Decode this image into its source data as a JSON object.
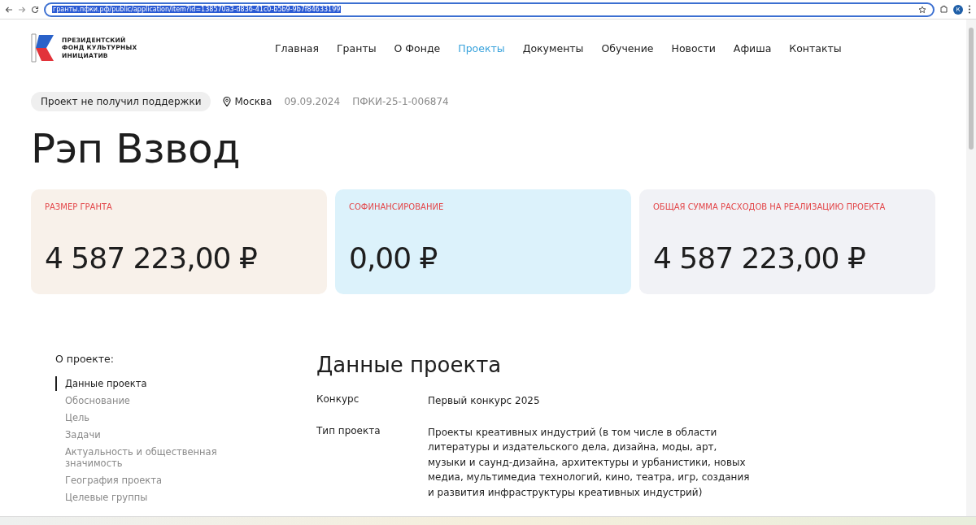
{
  "browser": {
    "url": "гранты.пфки.рф/public/application/item?id=138570a3-d836-41c0-b5b9-9b7f84633199",
    "profile_initial": "К"
  },
  "header": {
    "logo_text": [
      "ПРЕЗИДЕНТСКИЙ",
      "ФОНД КУЛЬТУРНЫХ",
      "ИНИЦИАТИВ"
    ],
    "nav": [
      {
        "label": "Главная",
        "selected": false
      },
      {
        "label": "Гранты",
        "selected": false
      },
      {
        "label": "О Фонде",
        "selected": false
      },
      {
        "label": "Проекты",
        "selected": true
      },
      {
        "label": "Документы",
        "selected": false
      },
      {
        "label": "Обучение",
        "selected": false
      },
      {
        "label": "Новости",
        "selected": false
      },
      {
        "label": "Афиша",
        "selected": false
      },
      {
        "label": "Контакты",
        "selected": false
      }
    ]
  },
  "meta": {
    "status": "Проект не получил поддержки",
    "city": "Москва",
    "date": "09.09.2024",
    "code": "ПФКИ-25-1-006874"
  },
  "title": "Рэп Взвод",
  "cards": [
    {
      "label": "РАЗМЕР ГРАНТА",
      "value": "4 587 223,00 ₽",
      "color": "#f8f1ea"
    },
    {
      "label": "СОФИНАНСИРОВАНИЕ",
      "value": "0,00 ₽",
      "color": "#dcf2fb"
    },
    {
      "label": "ОБЩАЯ СУММА РАСХОДОВ НА РЕАЛИЗАЦИЮ ПРОЕКТА",
      "value": "4 587 223,00 ₽",
      "color": "#f1f2f6"
    }
  ],
  "sidebar": {
    "title": "О проекте:",
    "items": [
      {
        "label": "Данные проекта",
        "selected": true
      },
      {
        "label": "Обоснование",
        "selected": false
      },
      {
        "label": "Цель",
        "selected": false
      },
      {
        "label": "Задачи",
        "selected": false
      },
      {
        "label": "Актуальность и общественная значимость",
        "selected": false
      },
      {
        "label": "География проекта",
        "selected": false
      },
      {
        "label": "Целевые группы",
        "selected": false
      }
    ]
  },
  "section": {
    "title": "Данные проекта",
    "rows": [
      {
        "label": "Конкурс",
        "value": "Первый конкурс 2025"
      },
      {
        "label": "Тип проекта",
        "value": "Проекты креативных индустрий (в том числе в области литературы и издательского дела, дизайна, моды, арт, музыки и саунд-дизайна, архитектуры и урбанистики, новых медиа, мультимедиа технологий, кино, театра, игр, создания и развития инфраструктуры креативных индустрий)"
      }
    ]
  }
}
